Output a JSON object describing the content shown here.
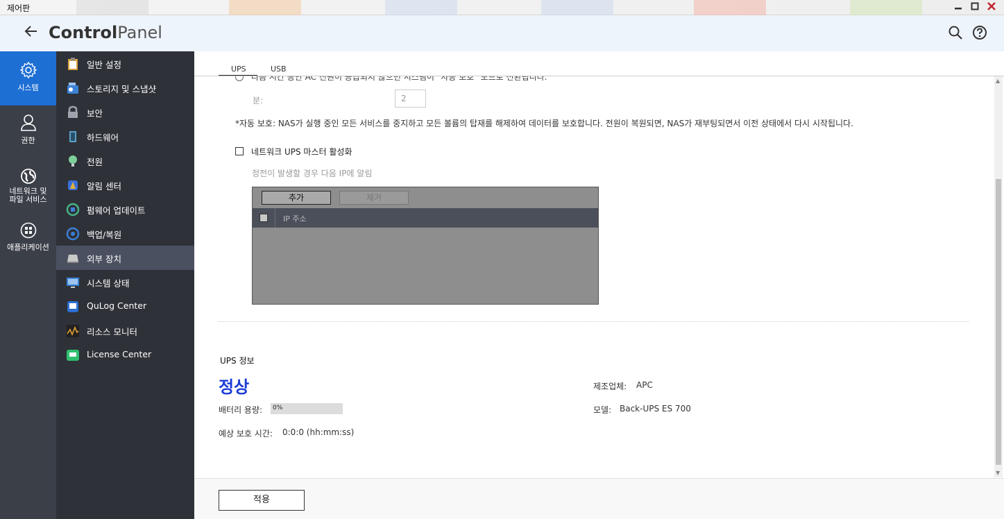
{
  "window": {
    "title": "제어판"
  },
  "header": {
    "brand_bold": "Control",
    "brand_light": "Panel"
  },
  "rail": [
    {
      "label": "시스템",
      "icon": "gear-icon",
      "active": true
    },
    {
      "label": "권한",
      "icon": "user-icon",
      "active": false
    },
    {
      "label": "네트워크 및\n파일 서비스",
      "icon": "globe-icon",
      "active": false
    },
    {
      "label": "애플리케이션",
      "icon": "apps-icon",
      "active": false
    }
  ],
  "submenu": [
    {
      "label": "일반 설정",
      "icon": "clipboard-icon",
      "color": "#d9a441"
    },
    {
      "label": "스토리지 및 스냅샷",
      "icon": "storage-icon",
      "color": "#3b82d6"
    },
    {
      "label": "보안",
      "icon": "lock-icon",
      "color": "#9ea3ad"
    },
    {
      "label": "하드웨어",
      "icon": "hardware-icon",
      "color": "#5aa0c8"
    },
    {
      "label": "전원",
      "icon": "bulb-icon",
      "color": "#7fcf9a"
    },
    {
      "label": "알림 센터",
      "icon": "notification-icon",
      "color": "#e2b33a"
    },
    {
      "label": "펌웨어 업데이트",
      "icon": "firmware-icon",
      "color": "#46b38a"
    },
    {
      "label": "백업/복원",
      "icon": "backup-icon",
      "color": "#3b7fd6"
    },
    {
      "label": "외부 장치",
      "icon": "external-device-icon",
      "color": "#c8c8c8",
      "active": true
    },
    {
      "label": "시스템 상태",
      "icon": "monitor-icon",
      "color": "#3b82d6"
    },
    {
      "label": "QuLog Center",
      "icon": "qulog-icon",
      "color": "#2d6fd1"
    },
    {
      "label": "리소스 모니터",
      "icon": "resource-monitor-icon",
      "color": "#e0a030"
    },
    {
      "label": "License Center",
      "icon": "license-icon",
      "color": "#2fbf6f"
    }
  ],
  "tabs": [
    "UPS",
    "USB"
  ],
  "content": {
    "partial_line": "다음 시간 동안 AC 전원이 공급되지 않으면 시스템이 \"자동 보호\" 모드로 전환됩니다.",
    "minutes_label": "분:",
    "minutes_value": "2",
    "auto_protect_note": "*자동 보호: NAS가 실행 중인 모든 서비스를 중지하고 모든 볼륨의 탑재를 해제하여 데이터를 보호합니다. 전원이 복원되면, NAS가 재부팅되면서 이전 상태에서 다시 시작됩니다.",
    "network_master_label": "네트워크 UPS 마스터 활성화",
    "notify_label": "정전이 발생할 경우 다음 IP에 알림",
    "add_button": "추가",
    "remove_button": "제거",
    "ip_column": "IP 주소"
  },
  "ups_info": {
    "section_title": "UPS 정보",
    "status": "정상",
    "battery_label": "배터리 용량:",
    "battery_percent": 0,
    "battery_text": "0%",
    "runtime_label": "예상 보호 시간:",
    "runtime_value": "0:0:0 (hh:mm:ss)",
    "manufacturer_label": "제조업체:",
    "manufacturer_value": "APC",
    "model_label": "모델:",
    "model_value": "Back-UPS ES 700"
  },
  "footer": {
    "apply_label": "적용"
  }
}
